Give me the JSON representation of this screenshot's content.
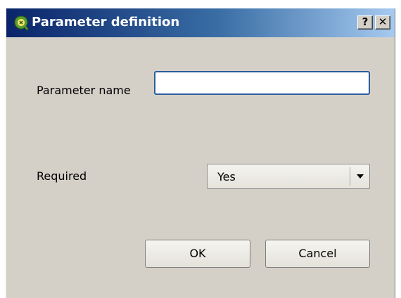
{
  "window": {
    "title": "Parameter definition",
    "help_label": "?",
    "close_label": "✕"
  },
  "form": {
    "param_name_label": "Parameter name",
    "param_name_value": "",
    "param_name_placeholder": "",
    "required_label": "Required",
    "required_selected": "Yes"
  },
  "buttons": {
    "ok_label": "OK",
    "cancel_label": "Cancel"
  },
  "colors": {
    "titlebar_start": "#0a246a",
    "titlebar_end": "#a6caf0",
    "window_bg": "#d4d0c8",
    "input_focus_border": "#2b5d9c"
  },
  "icons": {
    "app_icon": "qgis-icon",
    "dropdown_icon": "chevron-down-icon"
  }
}
